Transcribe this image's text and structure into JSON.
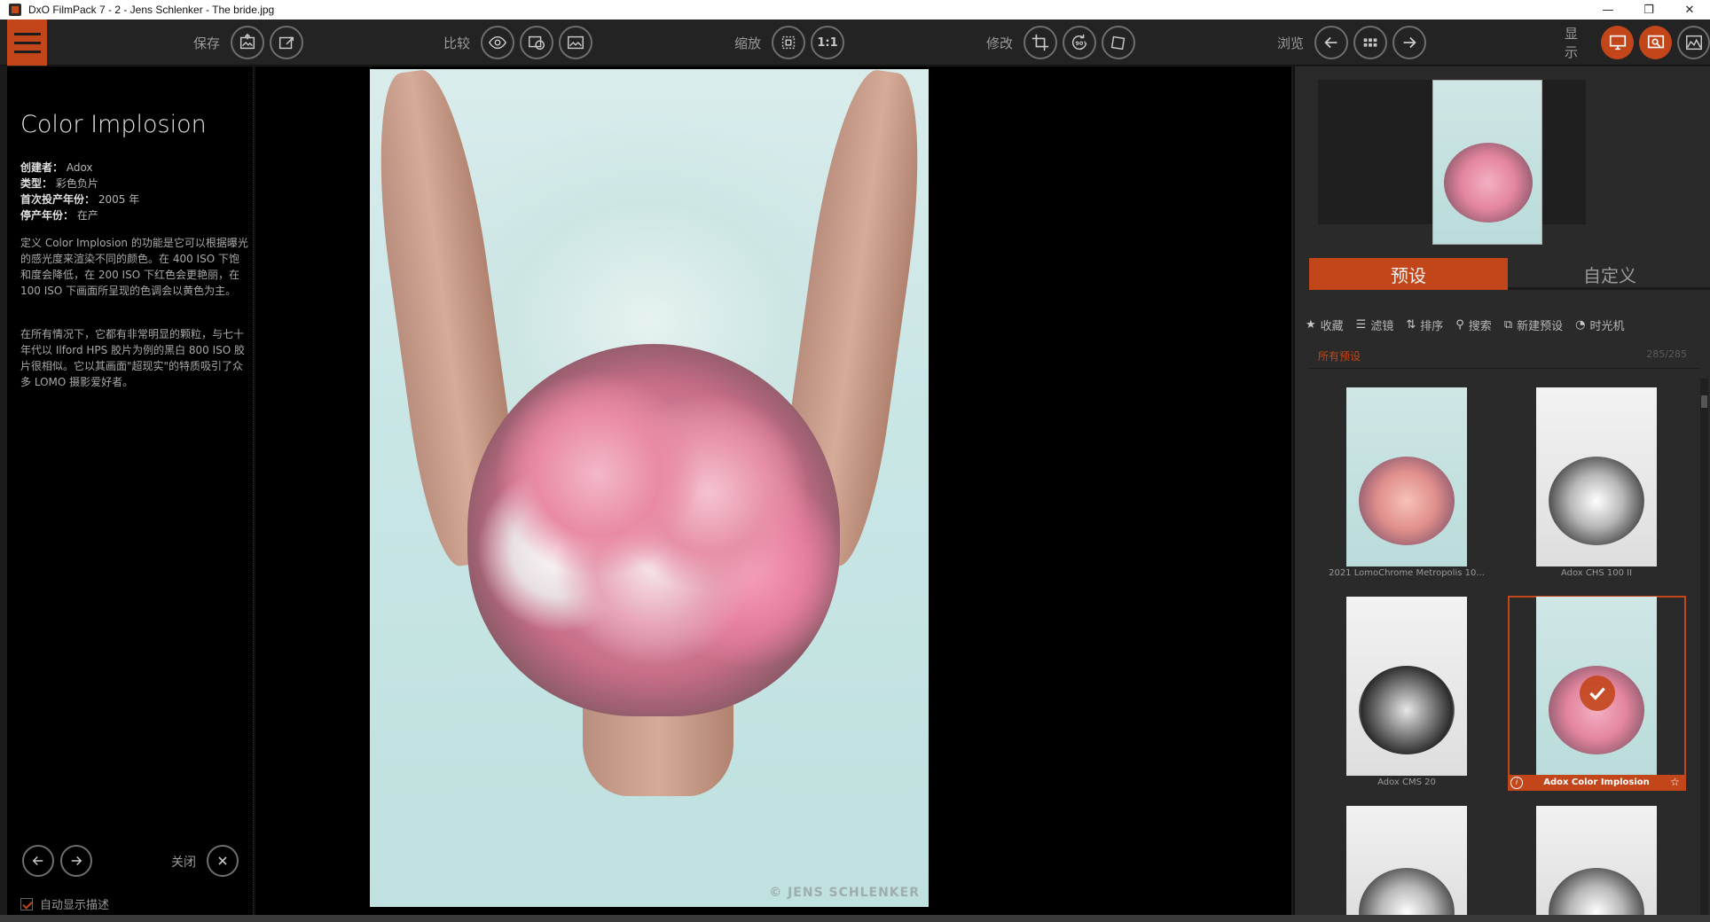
{
  "window": {
    "title": "DxO FilmPack 7 - 2 - Jens Schlenker - The bride.jpg",
    "controls": [
      "—",
      "❐",
      "✕"
    ]
  },
  "toolbar": {
    "save_label": "保存",
    "compare_label": "比较",
    "zoom_label": "缩放",
    "zoom_1to1": "1:1",
    "edit_label": "修改",
    "browse_label": "浏览",
    "display_label": "显示"
  },
  "info": {
    "title": "Color Implosion",
    "creator_label": "创建者：",
    "creator_value": "Adox",
    "type_label": "类型：",
    "type_value": "彩色负片",
    "first_year_label": "首次投产年份：",
    "first_year_value": "2005 年",
    "end_year_label": "停产年份：",
    "end_year_value": "在产",
    "paragraph1": "定义 Color Implosion 的功能是它可以根据曝光的感光度来渲染不同的颜色。在 400 ISO 下饱和度会降低，在 200 ISO 下红色会更艳丽，在 100 ISO 下画面所呈现的色调会以黄色为主。",
    "paragraph2": "在所有情况下，它都有非常明显的颗粒，与七十年代以 Ilford HPS 胶片为例的黑白 800 ISO 胶片很相似。它以其画面\"超现实\"的特质吸引了众多 LOMO 摄影爱好者。",
    "close_label": "关闭",
    "auto_show_label": "自动显示描述"
  },
  "image": {
    "copyright": "© JENS SCHLENKER"
  },
  "presets": {
    "tab_presets": "预设",
    "tab_custom": "自定义",
    "filter_favorites": "收藏",
    "filter_filter": "滤镜",
    "filter_sort": "排序",
    "filter_search": "搜索",
    "filter_new": "新建预设",
    "filter_timemachine": "时光机",
    "all_presets": "所有预设",
    "count": "285/285",
    "items": [
      {
        "label": "2021 LomoChrome Metropolis 10..."
      },
      {
        "label": "Adox CHS 100 II"
      },
      {
        "label": "Adox CMS 20"
      },
      {
        "label": "Adox Color Implosion"
      }
    ]
  },
  "colors": {
    "accent": "#c2461a",
    "background": "#000000",
    "panel": "#2a2a2a"
  }
}
